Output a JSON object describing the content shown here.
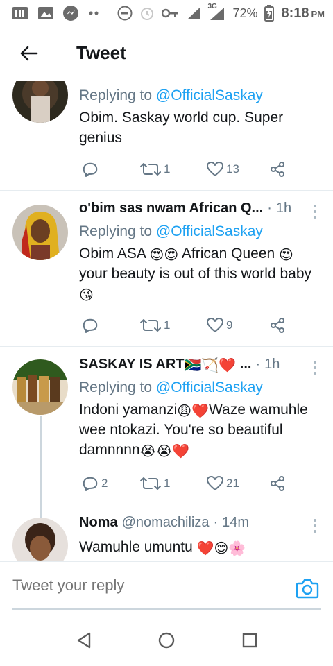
{
  "status_bar": {
    "network": "3G",
    "battery": "72%",
    "time": "8:18",
    "ampm": "PM"
  },
  "header": {
    "title": "Tweet"
  },
  "tweets": [
    {
      "name": "",
      "handle": "",
      "time": "",
      "reply_prefix": "Replying to ",
      "reply_to": "@OfficialSaskay",
      "text": "Obim. Saskay world cup. Super genius",
      "replies": "",
      "retweets": "1",
      "likes": "13"
    },
    {
      "name": "o'bim sas nwam African Q...",
      "handle": "",
      "time": "1h",
      "reply_prefix": "Replying to ",
      "reply_to": "@OfficialSaskay",
      "text_parts": [
        "Obim ASA ",
        "😍😍",
        " African Queen ",
        "😍",
        " your beauty is out of this world baby ",
        "😘"
      ],
      "replies": "",
      "retweets": "1",
      "likes": "9"
    },
    {
      "name": "SASKAY IS ART",
      "name_emoji": "🇿🇦🏹❤️",
      "name_suffix": " ...",
      "handle": "",
      "time": "1h",
      "reply_prefix": "Replying to ",
      "reply_to": "@OfficialSaskay",
      "text_parts": [
        "Indoni yamanzi",
        "😩❤️",
        "Waze wamuhle wee ntokazi. You're so beautiful damnnnn",
        "😭😭❤️"
      ],
      "replies": "2",
      "retweets": "1",
      "likes": "21"
    },
    {
      "name": "Noma",
      "handle": "@nomachiliza",
      "time": "14m",
      "text_parts": [
        "Wamuhle umuntu ",
        "❤️😊🌸"
      ]
    }
  ],
  "reply_bar": {
    "placeholder": "Tweet your reply"
  },
  "colors": {
    "accent": "#1da1f2",
    "secondary_text": "#657786",
    "divider": "#e6ecf0"
  },
  "icons": [
    "back-arrow-icon",
    "reply-icon",
    "retweet-icon",
    "like-icon",
    "share-icon",
    "more-icon",
    "camera-icon",
    "back-nav-icon",
    "home-nav-icon",
    "recents-nav-icon"
  ]
}
